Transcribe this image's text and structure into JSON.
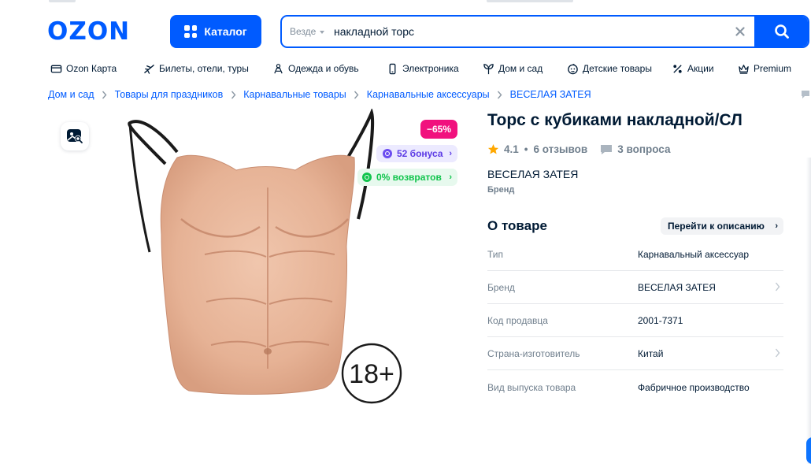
{
  "header": {
    "logo_text": "OZON",
    "catalog_label": "Каталог",
    "search": {
      "scope": "Везде",
      "value": "накладной торс"
    }
  },
  "nav": {
    "items": [
      {
        "label": "Ozon Карта",
        "icon": "card-icon"
      },
      {
        "label": "Билеты, отели, туры",
        "icon": "plane-icon"
      },
      {
        "label": "Одежда и обувь",
        "icon": "clothes-icon"
      },
      {
        "label": "Электроника",
        "icon": "phone-icon"
      },
      {
        "label": "Дом и сад",
        "icon": "plant-icon"
      },
      {
        "label": "Детские товары",
        "icon": "baby-icon"
      },
      {
        "label": "Акции",
        "icon": "percent-icon"
      },
      {
        "label": "Premium",
        "icon": "crown-icon"
      }
    ]
  },
  "breadcrumbs": [
    "Дом и сад",
    "Товары для праздников",
    "Карнавальные товары",
    "Карнавальные аксессуары",
    "ВЕСЕЛАЯ ЗАТЕЯ"
  ],
  "gallery": {
    "discount": "−65%",
    "bonus": "52 бонуса",
    "returns": "0% возвратов",
    "age_label": "18+"
  },
  "product": {
    "title": "Торс с кубиками накладной/СЛ",
    "rating": "4.1",
    "reviews": "6 отзывов",
    "questions": "3 вопроса",
    "brand": "ВЕСЕЛАЯ ЗАТЕЯ",
    "brand_caption": "Бренд"
  },
  "about": {
    "title": "О товаре",
    "goto_label": "Перейти к описанию",
    "specs": [
      {
        "key": "Тип",
        "value": "Карнавальный аксессуар",
        "link": false
      },
      {
        "key": "Бренд",
        "value": "ВЕСЕЛАЯ ЗАТЕЯ",
        "link": true
      },
      {
        "key": "Код продавца",
        "value": "2001-7371",
        "link": false
      },
      {
        "key": "Страна-изготовитель",
        "value": "Китай",
        "link": true
      },
      {
        "key": "Вид выпуска товара",
        "value": "Фабричное производство",
        "link": false
      }
    ]
  },
  "colors": {
    "brand_blue": "#005bff",
    "discount_pink": "#f1117e",
    "bonus_purple": "#5b3ae5",
    "returns_green": "#10c44c"
  }
}
